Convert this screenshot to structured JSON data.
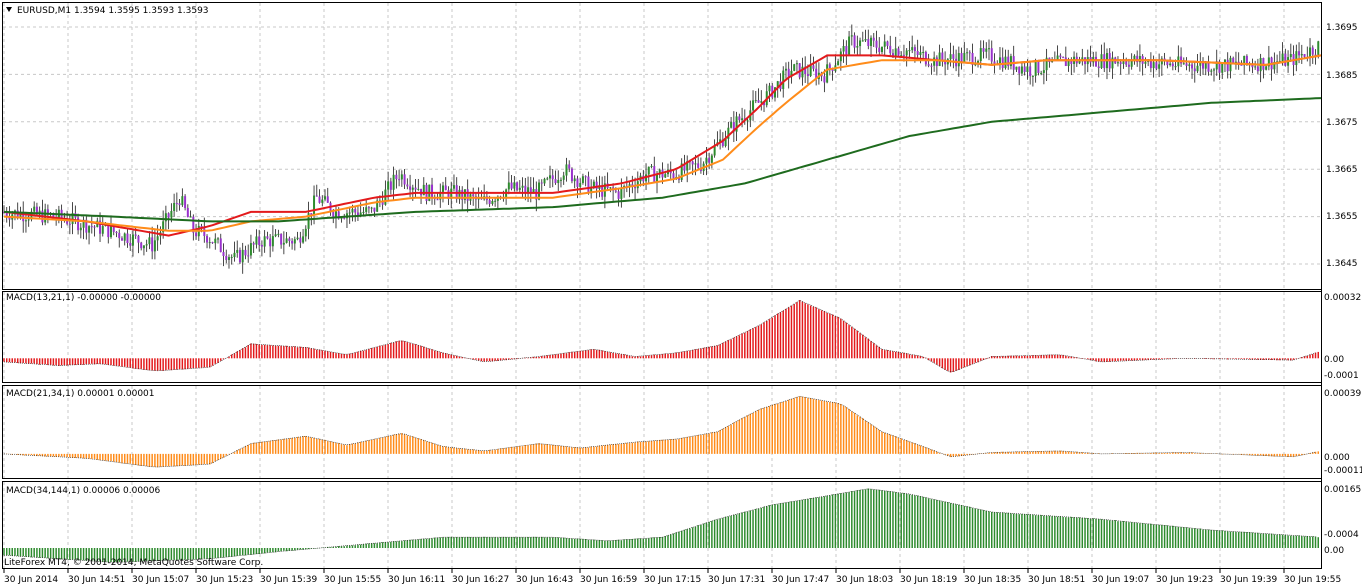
{
  "main_panel": {
    "title": "EURUSD,M1  1.3594 1.3595 1.3593 1.3593",
    "price_labels": [
      "1.3695",
      "1.3685",
      "1.3675",
      "1.3665",
      "1.3655",
      "1.3645"
    ],
    "watermark": "LiteForex MT4, © 2001-2014, MetaQuotes Software Corp."
  },
  "macd1": {
    "title": "MACD(13,21,1) -0.00000 -0.00000",
    "labels": [
      "0.00032",
      "0.00",
      "-0.0001"
    ]
  },
  "macd2": {
    "title": "MACD(21,34,1) 0.00001 0.00001",
    "labels": [
      "0.00039",
      "0.000",
      "-0.00011"
    ]
  },
  "macd3": {
    "title": "MACD(34,144,1) 0.00006 0.00006",
    "labels": [
      "0.00165",
      "-0.0004",
      "0.00"
    ]
  },
  "time_labels": [
    "30 Jun 2014",
    "30 Jun 14:51",
    "30 Jun 15:07",
    "30 Jun 15:23",
    "30 Jun 15:39",
    "30 Jun 15:55",
    "30 Jun 16:11",
    "30 Jun 16:27",
    "30 Jun 16:43",
    "30 Jun 16:59",
    "30 Jun 17:15",
    "30 Jun 17:31",
    "30 Jun 17:47",
    "30 Jun 18:03",
    "30 Jun 18:19",
    "30 Jun 18:35",
    "30 Jun 18:51",
    "30 Jun 19:07",
    "30 Jun 19:23",
    "30 Jun 19:39",
    "30 Jun 19:55"
  ],
  "colors": {
    "bull_candle": "#2e8b2e",
    "bear_candle": "#9932cc",
    "ma_fast": "#e31a1c",
    "ma_mid": "#ff8c1a",
    "ma_slow": "#1e6b1e",
    "macd1": "#e31a1c",
    "macd2": "#ff8c1a",
    "macd3": "#2e8b2e",
    "grid": "#c8c8c8"
  },
  "chart_data": [
    {
      "type": "candlestick",
      "symbol": "EURUSD",
      "timeframe": "M1",
      "ylim": [
        1.3641,
        1.3699
      ],
      "close_path": [
        [
          0,
          1.3656
        ],
        [
          20,
          1.3655
        ],
        [
          40,
          1.3652
        ],
        [
          55,
          1.3649
        ],
        [
          65,
          1.3659
        ],
        [
          70,
          1.3652
        ],
        [
          75,
          1.3651
        ],
        [
          85,
          1.3646
        ],
        [
          95,
          1.365
        ],
        [
          108,
          1.365
        ],
        [
          115,
          1.3659
        ],
        [
          122,
          1.3656
        ],
        [
          135,
          1.3656
        ],
        [
          145,
          1.3664
        ],
        [
          155,
          1.366
        ],
        [
          165,
          1.366
        ],
        [
          175,
          1.3658
        ],
        [
          185,
          1.3661
        ],
        [
          195,
          1.366
        ],
        [
          205,
          1.3665
        ],
        [
          215,
          1.3661
        ],
        [
          225,
          1.366
        ],
        [
          235,
          1.3664
        ],
        [
          245,
          1.3664
        ],
        [
          255,
          1.3666
        ],
        [
          268,
          1.3675
        ],
        [
          280,
          1.3681
        ],
        [
          288,
          1.3686
        ],
        [
          300,
          1.3685
        ],
        [
          310,
          1.3692
        ],
        [
          320,
          1.3691
        ],
        [
          330,
          1.369
        ],
        [
          340,
          1.3688
        ],
        [
          360,
          1.3689
        ],
        [
          375,
          1.3686
        ],
        [
          390,
          1.3688
        ],
        [
          410,
          1.3688
        ],
        [
          430,
          1.3687
        ],
        [
          450,
          1.3687
        ],
        [
          470,
          1.3688
        ],
        [
          480,
          1.3691
        ]
      ],
      "moving_averages": [
        {
          "name": "fast",
          "points": [
            [
              0,
              1.3656
            ],
            [
              30,
              1.3654
            ],
            [
              60,
              1.3651
            ],
            [
              75,
              1.3653
            ],
            [
              90,
              1.3656
            ],
            [
              110,
              1.3656
            ],
            [
              135,
              1.3659
            ],
            [
              150,
              1.366
            ],
            [
              175,
              1.366
            ],
            [
              200,
              1.366
            ],
            [
              225,
              1.3662
            ],
            [
              245,
              1.3665
            ],
            [
              262,
              1.3671
            ],
            [
              275,
              1.3678
            ],
            [
              285,
              1.3684
            ],
            [
              300,
              1.3689
            ],
            [
              320,
              1.3689
            ],
            [
              340,
              1.3688
            ],
            [
              360,
              1.3687
            ],
            [
              380,
              1.3688
            ],
            [
              420,
              1.3688
            ],
            [
              460,
              1.3687
            ],
            [
              480,
              1.3689
            ]
          ]
        },
        {
          "name": "mid",
          "points": [
            [
              0,
              1.3655
            ],
            [
              30,
              1.3654
            ],
            [
              60,
              1.3652
            ],
            [
              75,
              1.3652
            ],
            [
              90,
              1.3654
            ],
            [
              110,
              1.3655
            ],
            [
              135,
              1.3658
            ],
            [
              150,
              1.3659
            ],
            [
              175,
              1.3659
            ],
            [
              200,
              1.3659
            ],
            [
              225,
              1.3661
            ],
            [
              245,
              1.3663
            ],
            [
              262,
              1.3667
            ],
            [
              275,
              1.3674
            ],
            [
              285,
              1.3679
            ],
            [
              300,
              1.3686
            ],
            [
              320,
              1.3688
            ],
            [
              340,
              1.3688
            ],
            [
              360,
              1.3687
            ],
            [
              380,
              1.3688
            ],
            [
              420,
              1.3688
            ],
            [
              460,
              1.3687
            ],
            [
              480,
              1.3689
            ]
          ]
        },
        {
          "name": "slow",
          "points": [
            [
              0,
              1.3656
            ],
            [
              40,
              1.3655
            ],
            [
              75,
              1.3654
            ],
            [
              100,
              1.3654
            ],
            [
              150,
              1.3656
            ],
            [
              200,
              1.3657
            ],
            [
              240,
              1.3659
            ],
            [
              270,
              1.3662
            ],
            [
              300,
              1.3667
            ],
            [
              330,
              1.3672
            ],
            [
              360,
              1.3675
            ],
            [
              400,
              1.3677
            ],
            [
              440,
              1.3679
            ],
            [
              480,
              1.368
            ]
          ]
        }
      ]
    },
    {
      "type": "histogram",
      "name": "MACD(13,21,1)",
      "ylim": [
        -0.00012,
        0.00035
      ],
      "values_path": [
        [
          0,
          -2e-05
        ],
        [
          20,
          -4e-05
        ],
        [
          35,
          -3e-05
        ],
        [
          55,
          -7e-05
        ],
        [
          75,
          -5e-05
        ],
        [
          90,
          8e-05
        ],
        [
          110,
          6e-05
        ],
        [
          125,
          2e-05
        ],
        [
          145,
          0.0001
        ],
        [
          160,
          3e-05
        ],
        [
          175,
          -2e-05
        ],
        [
          195,
          1e-05
        ],
        [
          215,
          5e-05
        ],
        [
          230,
          1e-05
        ],
        [
          245,
          3e-05
        ],
        [
          260,
          7e-05
        ],
        [
          275,
          0.00018
        ],
        [
          290,
          0.00032
        ],
        [
          305,
          0.00022
        ],
        [
          320,
          5e-05
        ],
        [
          335,
          1e-05
        ],
        [
          345,
          -8e-05
        ],
        [
          360,
          1e-05
        ],
        [
          385,
          2e-05
        ],
        [
          400,
          -2e-05
        ],
        [
          430,
          0.0
        ],
        [
          470,
          -1e-05
        ],
        [
          480,
          4e-05
        ]
      ]
    },
    {
      "type": "histogram",
      "name": "MACD(21,34,1)",
      "ylim": [
        -0.00015,
        0.00044
      ],
      "values_path": [
        [
          0,
          0.0
        ],
        [
          30,
          -3e-05
        ],
        [
          55,
          -9e-05
        ],
        [
          75,
          -7e-05
        ],
        [
          90,
          7e-05
        ],
        [
          110,
          0.00012
        ],
        [
          125,
          6e-05
        ],
        [
          145,
          0.00014
        ],
        [
          160,
          5e-05
        ],
        [
          175,
          2e-05
        ],
        [
          195,
          7e-05
        ],
        [
          210,
          4e-05
        ],
        [
          230,
          8e-05
        ],
        [
          245,
          0.0001
        ],
        [
          260,
          0.00015
        ],
        [
          275,
          0.0003
        ],
        [
          290,
          0.00039
        ],
        [
          305,
          0.00034
        ],
        [
          320,
          0.00015
        ],
        [
          335,
          5e-05
        ],
        [
          345,
          -2e-05
        ],
        [
          360,
          1e-05
        ],
        [
          385,
          2e-05
        ],
        [
          400,
          0.0
        ],
        [
          430,
          1e-05
        ],
        [
          470,
          -2e-05
        ],
        [
          480,
          2e-05
        ]
      ]
    },
    {
      "type": "histogram",
      "name": "MACD(34,144,1)",
      "ylim": [
        -0.0005,
        0.00175
      ],
      "values_path": [
        [
          0,
          -0.0002
        ],
        [
          40,
          -0.0004
        ],
        [
          75,
          -0.0003
        ],
        [
          100,
          -0.0001
        ],
        [
          130,
          0.0001
        ],
        [
          160,
          0.0003
        ],
        [
          200,
          0.0003
        ],
        [
          220,
          0.0002
        ],
        [
          240,
          0.0003
        ],
        [
          260,
          0.0008
        ],
        [
          280,
          0.0012
        ],
        [
          300,
          0.00145
        ],
        [
          315,
          0.00165
        ],
        [
          330,
          0.0015
        ],
        [
          360,
          0.001
        ],
        [
          400,
          0.0008
        ],
        [
          440,
          0.0005
        ],
        [
          480,
          0.0003
        ]
      ]
    }
  ]
}
